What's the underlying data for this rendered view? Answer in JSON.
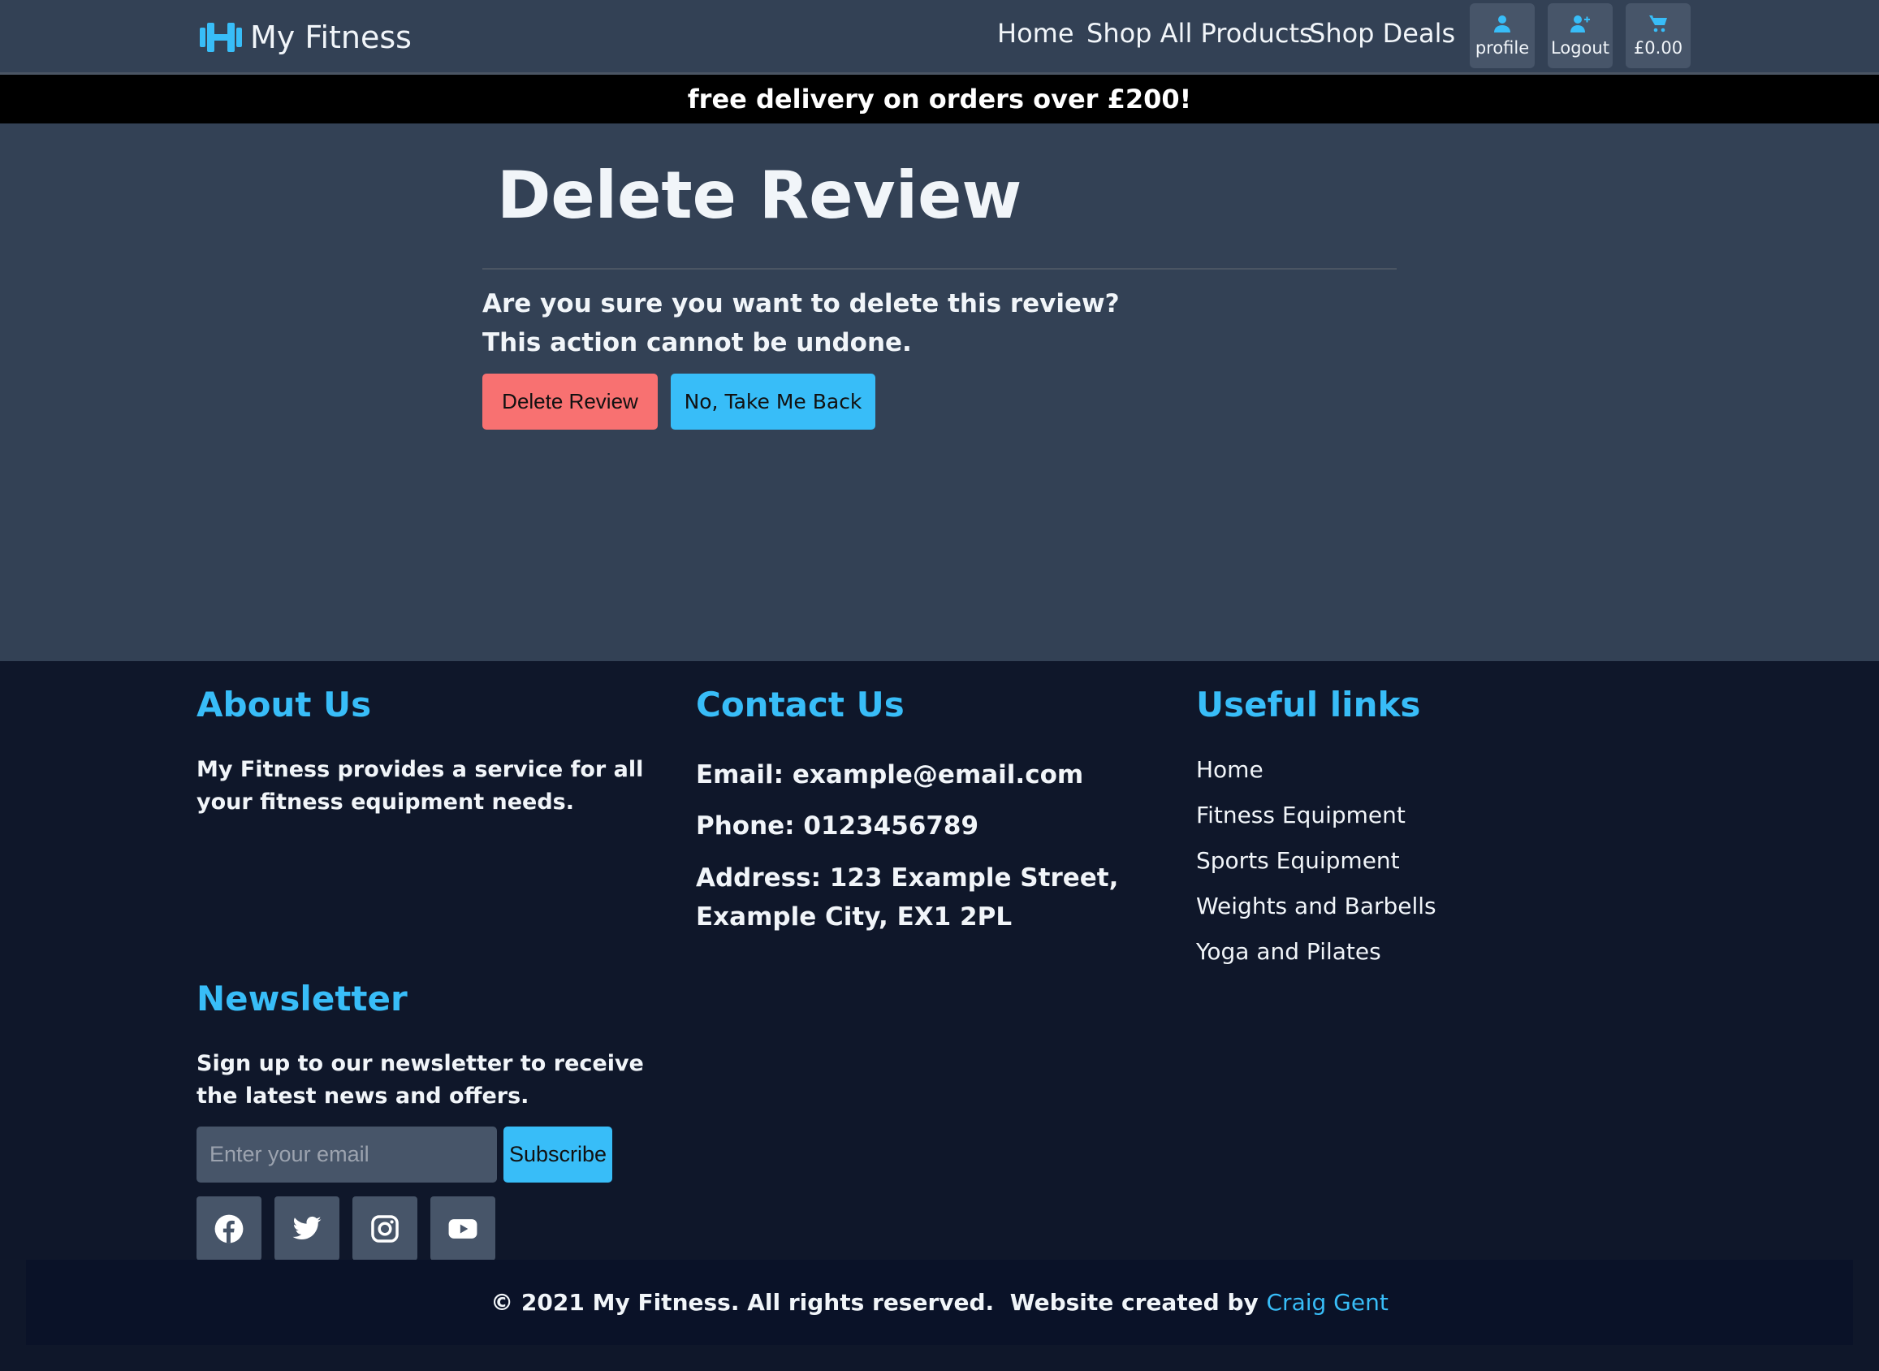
{
  "navbar": {
    "brand": "My Fitness",
    "links": [
      "Home",
      "Shop All Products",
      "Shop Deals"
    ],
    "profile_label": "profile",
    "logout_label": "Logout",
    "cart_total": "£0.00"
  },
  "banner": {
    "text": "free delivery on orders over £200!"
  },
  "main": {
    "title": "Delete Review",
    "confirm_line1": "Are you sure you want to delete this review?",
    "confirm_line2": "This action cannot be undone.",
    "delete_label": "Delete Review",
    "back_label": "No, Take Me Back"
  },
  "footer": {
    "about_heading": "About Us",
    "about_text": "My Fitness provides a service for all your fitness equipment needs.",
    "contact_heading": "Contact Us",
    "email": "Email: example@email.com",
    "phone": "Phone: 0123456789",
    "address": "Address: 123 Example Street, Example City, EX1 2PL",
    "links_heading": "Useful links",
    "links": [
      "Home",
      "Fitness Equipment",
      "Sports Equipment",
      "Weights and Barbells",
      "Yoga and Pilates"
    ],
    "newsletter_heading": "Newsletter",
    "newsletter_text": "Sign up to our newsletter to receive the latest news and offers.",
    "email_placeholder": "Enter your email",
    "subscribe_label": "Subscribe",
    "social_icons": [
      "facebook-icon",
      "twitter-icon",
      "instagram-icon",
      "youtube-icon"
    ]
  },
  "copyright": {
    "text": "© 2021 My Fitness. All rights reserved.  Website created by ",
    "author": "Craig Gent"
  },
  "colors": {
    "accent": "#38bdf8",
    "danger": "#f87171",
    "header_bg": "#334155",
    "footer_bg": "#0f172a"
  }
}
